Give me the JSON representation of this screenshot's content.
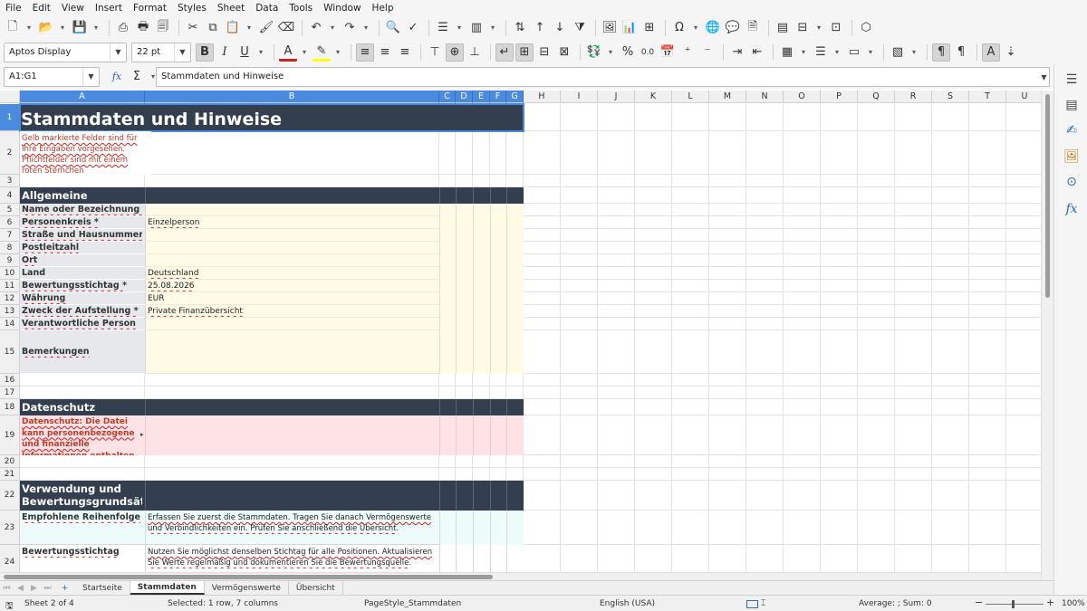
{
  "menu": [
    "File",
    "Edit",
    "View",
    "Insert",
    "Format",
    "Styles",
    "Sheet",
    "Data",
    "Tools",
    "Window",
    "Help"
  ],
  "toolbar": {
    "font_name": "Aptos Display",
    "font_size": "22 pt",
    "bold_label": "B",
    "italic_label": "I",
    "underline_label": "U",
    "font_color_label": "A",
    "percent_label": "%",
    "decimal_label": "0.0"
  },
  "formula_bar": {
    "name_box": "A1:G1",
    "fx_label": "fx",
    "sum_label": "Σ",
    "equals_label": "=",
    "content": "Stammdaten und Hinweise"
  },
  "columns": [
    "A",
    "B",
    "C",
    "D",
    "E",
    "F",
    "G",
    "H",
    "I",
    "J",
    "K",
    "L",
    "M",
    "N",
    "O",
    "P",
    "Q",
    "R",
    "S",
    "T",
    "U"
  ],
  "rows": [
    "1",
    "2",
    "3",
    "4",
    "5",
    "6",
    "7",
    "8",
    "9",
    "10",
    "11",
    "12",
    "13",
    "14",
    "15",
    "16",
    "17",
    "18",
    "19",
    "20",
    "21",
    "22",
    "23",
    "24"
  ],
  "sheet": {
    "title": "Stammdaten und Hinweise",
    "intro": "Gelb markierte Felder sind für Ihre Eingaben vorgesehen. Pflichtfelder sind mit einem roten Sternchen gekennzeichnet.",
    "section_general": "Allgemeine Angaben",
    "fields": [
      {
        "label": "Name oder Bezeichnung *",
        "value": ""
      },
      {
        "label": "Personenkreis *",
        "value": "Einzelperson"
      },
      {
        "label": "Straße und Hausnummer",
        "value": ""
      },
      {
        "label": "Postleitzahl",
        "value": ""
      },
      {
        "label": "Ort",
        "value": ""
      },
      {
        "label": "Land",
        "value": "Deutschland"
      },
      {
        "label": "Bewertungsstichtag *",
        "value": "25.08.2026"
      },
      {
        "label": "Währung",
        "value": "EUR"
      },
      {
        "label": "Zweck der Aufstellung *",
        "value": "Private Finanzübersicht"
      },
      {
        "label": "Verantwortliche Person",
        "value": ""
      },
      {
        "label": "Bemerkungen",
        "value": ""
      }
    ],
    "section_privacy": "Datenschutz",
    "privacy_text": "Datenschutz: Die Datei kann personenbezogene und finanzielle Informationen enthalten. Speichern Sie sie nur",
    "section_usage": "Verwendung und Bewertungsgrundsätze",
    "usage": [
      {
        "label": "Empfohlene Reihenfolge",
        "text": "Erfassen Sie zuerst die Stammdaten. Tragen Sie danach Vermögenswerte und Verbindlichkeiten ein. Prüfen Sie anschließend die Übersicht."
      },
      {
        "label": "Bewertungsstichtag",
        "text": "Nutzen Sie möglichst denselben Stichtag für alle Positionen. Aktualisieren Sie Werte regelmäßig und dokumentieren Sie die Bewertungsquelle."
      }
    ]
  },
  "tabs": [
    "Startseite",
    "Stammdaten",
    "Vermögenswerte",
    "Übersicht"
  ],
  "status": {
    "sheet": "Sheet 2 of 4",
    "selection": "Selected: 1 row, 7 columns",
    "page_style": "PageStyle_Stammdaten",
    "language": "English (USA)",
    "sum": "Average: ; Sum: 0",
    "zoom": "100%"
  },
  "colors": {
    "header_dark": "#333f4f",
    "label_gray": "#e6e8ec",
    "input_yellow": "#fffbe6",
    "privacy_pink": "#fde3e5",
    "usage_cyan": "#eefbfb",
    "selection_blue": "#4a8be0"
  }
}
